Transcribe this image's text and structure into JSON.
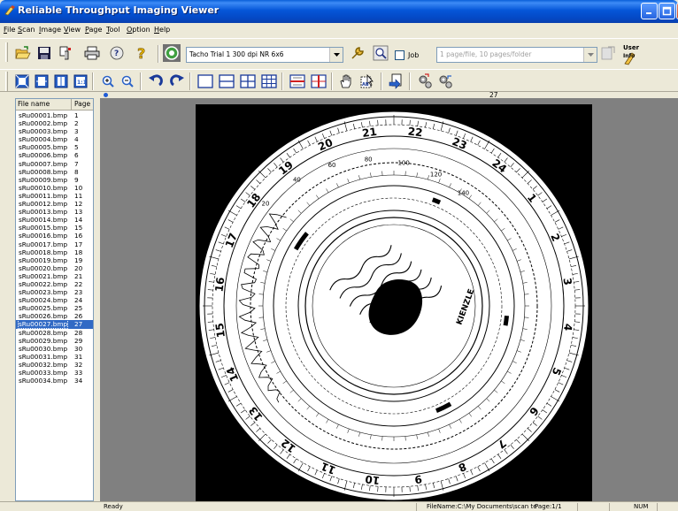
{
  "window": {
    "title": "Reliable Throughput Imaging Viewer"
  },
  "menu": [
    {
      "key": "F",
      "rest": "ile"
    },
    {
      "key": "S",
      "rest": "can"
    },
    {
      "key": "I",
      "rest": "mage"
    },
    {
      "key": "V",
      "rest": "iew"
    },
    {
      "key": "P",
      "rest": "age"
    },
    {
      "key": "T",
      "rest": "ool"
    },
    {
      "key": "O",
      "rest": "ption"
    },
    {
      "key": "H",
      "rest": "elp"
    }
  ],
  "toolbar": {
    "profile_value": "Tacho Trial 1 300 dpi NR 6x6",
    "job_label": "Job",
    "job_checked": false,
    "split_value": "1 page/file, 10 pages/folder",
    "user_label_top": "User",
    "user_label_bottom": "Info"
  },
  "file_list": {
    "header_file": "File name",
    "header_page": "Page",
    "selected_index": 26,
    "rows": [
      {
        "file": "sRu00001.bmp",
        "page": "1"
      },
      {
        "file": "sRu00002.bmp",
        "page": "2"
      },
      {
        "file": "sRu00003.bmp",
        "page": "3"
      },
      {
        "file": "sRu00004.bmp",
        "page": "4"
      },
      {
        "file": "sRu00005.bmp",
        "page": "5"
      },
      {
        "file": "sRu00006.bmp",
        "page": "6"
      },
      {
        "file": "sRu00007.bmp",
        "page": "7"
      },
      {
        "file": "sRu00008.bmp",
        "page": "8"
      },
      {
        "file": "sRu00009.bmp",
        "page": "9"
      },
      {
        "file": "sRu00010.bmp",
        "page": "10"
      },
      {
        "file": "sRu00011.bmp",
        "page": "11"
      },
      {
        "file": "sRu00012.bmp",
        "page": "12"
      },
      {
        "file": "sRu00013.bmp",
        "page": "13"
      },
      {
        "file": "sRu00014.bmp",
        "page": "14"
      },
      {
        "file": "sRu00015.bmp",
        "page": "15"
      },
      {
        "file": "sRu00016.bmp",
        "page": "16"
      },
      {
        "file": "sRu00017.bmp",
        "page": "17"
      },
      {
        "file": "sRu00018.bmp",
        "page": "18"
      },
      {
        "file": "sRu00019.bmp",
        "page": "19"
      },
      {
        "file": "sRu00020.bmp",
        "page": "20"
      },
      {
        "file": "sRu00021.bmp",
        "page": "21"
      },
      {
        "file": "sRu00022.bmp",
        "page": "22"
      },
      {
        "file": "sRu00023.bmp",
        "page": "23"
      },
      {
        "file": "sRu00024.bmp",
        "page": "24"
      },
      {
        "file": "sRu00025.bmp",
        "page": "25"
      },
      {
        "file": "sRu00026.bmp",
        "page": "26"
      },
      {
        "file": "sRu00027.bmp",
        "page": "27"
      },
      {
        "file": "sRu00028.bmp",
        "page": "28"
      },
      {
        "file": "sRu00029.bmp",
        "page": "29"
      },
      {
        "file": "sRu00030.bmp",
        "page": "30"
      },
      {
        "file": "sRu00031.bmp",
        "page": "31"
      },
      {
        "file": "sRu00032.bmp",
        "page": "32"
      },
      {
        "file": "sRu00033.bmp",
        "page": "33"
      },
      {
        "file": "sRu00034.bmp",
        "page": "34"
      }
    ]
  },
  "viewer": {
    "ruler_page": "27",
    "chart_hours": [
      "21",
      "22",
      "23",
      "24",
      "1",
      "2",
      "3",
      "4",
      "5",
      "6",
      "7",
      "8",
      "9",
      "10",
      "11",
      "12",
      "13",
      "14",
      "15",
      "16",
      "17",
      "18",
      "19",
      "20"
    ],
    "speed_marks": [
      "20",
      "40",
      "60",
      "80",
      "100",
      "120",
      "140"
    ],
    "chart_brand": "KIENZLE"
  },
  "status": {
    "ready": "Ready",
    "filename": "FileName:C:\\My Documents\\scan te",
    "page": "Page:1/1",
    "num": "NUM"
  },
  "icons": {
    "toolbar1": [
      "open-folder-icon",
      "save-icon",
      "scanner-icon",
      "print-icon",
      "scan-settings-icon",
      "help-icon",
      "profile-icon",
      "wrench-icon",
      "preview-icon",
      "batch-icon",
      "user-icon"
    ],
    "toolbar2": [
      "fit-page-icon",
      "fit-width-icon",
      "fit-height-icon",
      "actual-size-icon",
      "zoom-in-icon",
      "zoom-out-icon",
      "rotate-left-icon",
      "rotate-right-icon",
      "layout-single-icon",
      "layout-two-icon",
      "layout-four-icon",
      "layout-grid-icon",
      "split-h-icon",
      "split-v-icon",
      "hand-icon",
      "select-icon",
      "export-icon",
      "settings-gear-icon",
      "settings-gear2-icon"
    ]
  },
  "colors": {
    "title_bar": "#0556d8",
    "selection": "#316ac5",
    "viewer_bg": "#808080"
  }
}
